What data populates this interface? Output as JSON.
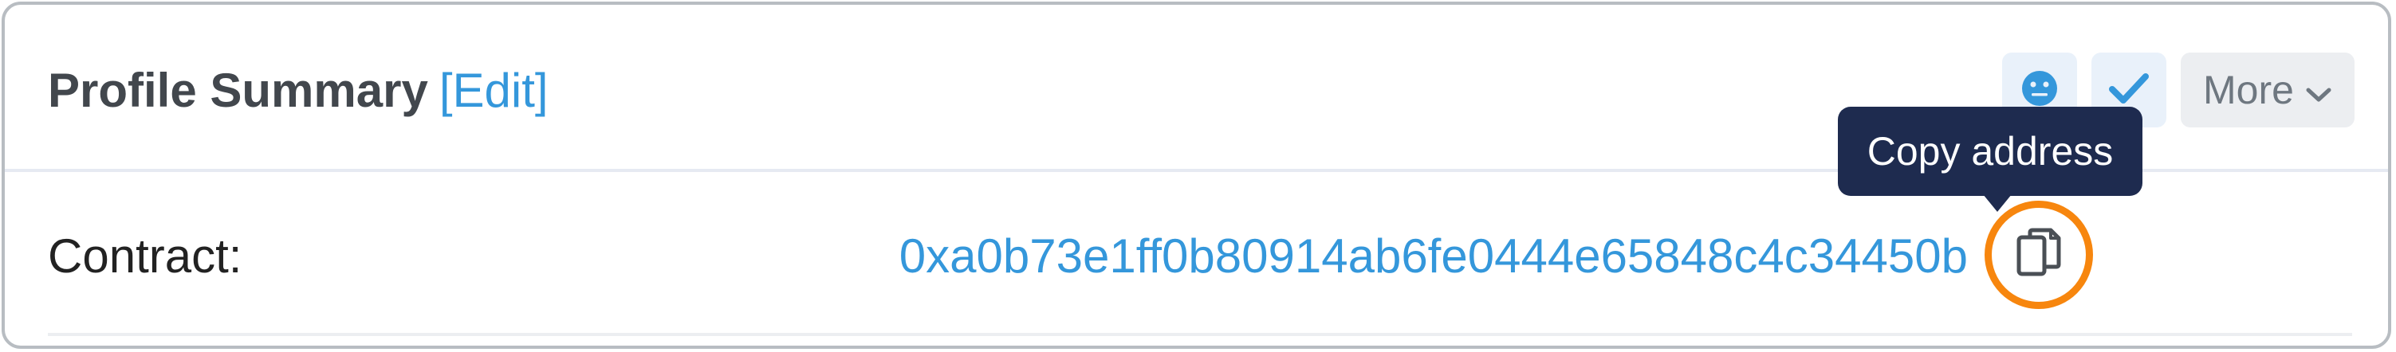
{
  "header": {
    "title": "Profile Summary",
    "edit_label": "[Edit]",
    "more_label": "More"
  },
  "contract_row": {
    "label": "Contract:",
    "address": "0xa0b73e1ff0b80914ab6fe0444e65848c4c34450b"
  },
  "tooltip": {
    "text": "Copy address"
  },
  "icons": {
    "face": "neutral-face-icon",
    "check": "checkmark-icon",
    "more_chevron": "chevron-down-icon",
    "copy": "copy-icon"
  },
  "colors": {
    "link": "#3497db",
    "title": "#42474d",
    "tooltip_bg": "#1e2b4f",
    "highlight_ring": "#f7860e",
    "icon_button_bg": "#e9f1fa",
    "more_button_bg": "#eceef1"
  }
}
